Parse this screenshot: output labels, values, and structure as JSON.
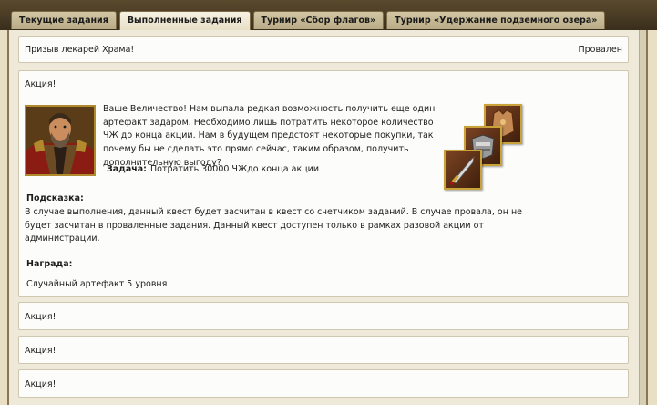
{
  "tabs": [
    {
      "label": "Текущие задания",
      "active": false
    },
    {
      "label": "Выполненные задания",
      "active": true
    },
    {
      "label": "Турнир «Сбор флагов»",
      "active": false
    },
    {
      "label": "Турнир «Удержание подземного озера»",
      "active": false
    }
  ],
  "quests": [
    {
      "title": "Призыв лекарей Храма!",
      "status": "Провален"
    },
    {
      "title": "Акция!",
      "description": "Ваше Величество! Нам выпала редкая возможность получить еще один артефакт задаром. Необходимо лишь потратить некоторое количество ЧЖ до конца акции. Нам в будущем предстоят некоторые покупки, так почему бы не сделать это прямо сейчас, таким образом, получить дополнительную выгоду?",
      "task_label": "Задача:",
      "task_text": "Потратить 30000 ЧЖдо конца акции",
      "hint_label": "Подсказка:",
      "hint_text": "В случае выполнения, данный квест будет засчитан в квест со счетчиком заданий. В случае провала, он не будет засчитан в проваленные задания. Данный квест доступен только в рамках разовой акции от администрации.",
      "reward_label": "Награда:",
      "reward_text": "Случайный артефакт 5  уровня"
    },
    {
      "title": "Акция!"
    },
    {
      "title": "Акция!"
    },
    {
      "title": "Акция!"
    }
  ]
}
